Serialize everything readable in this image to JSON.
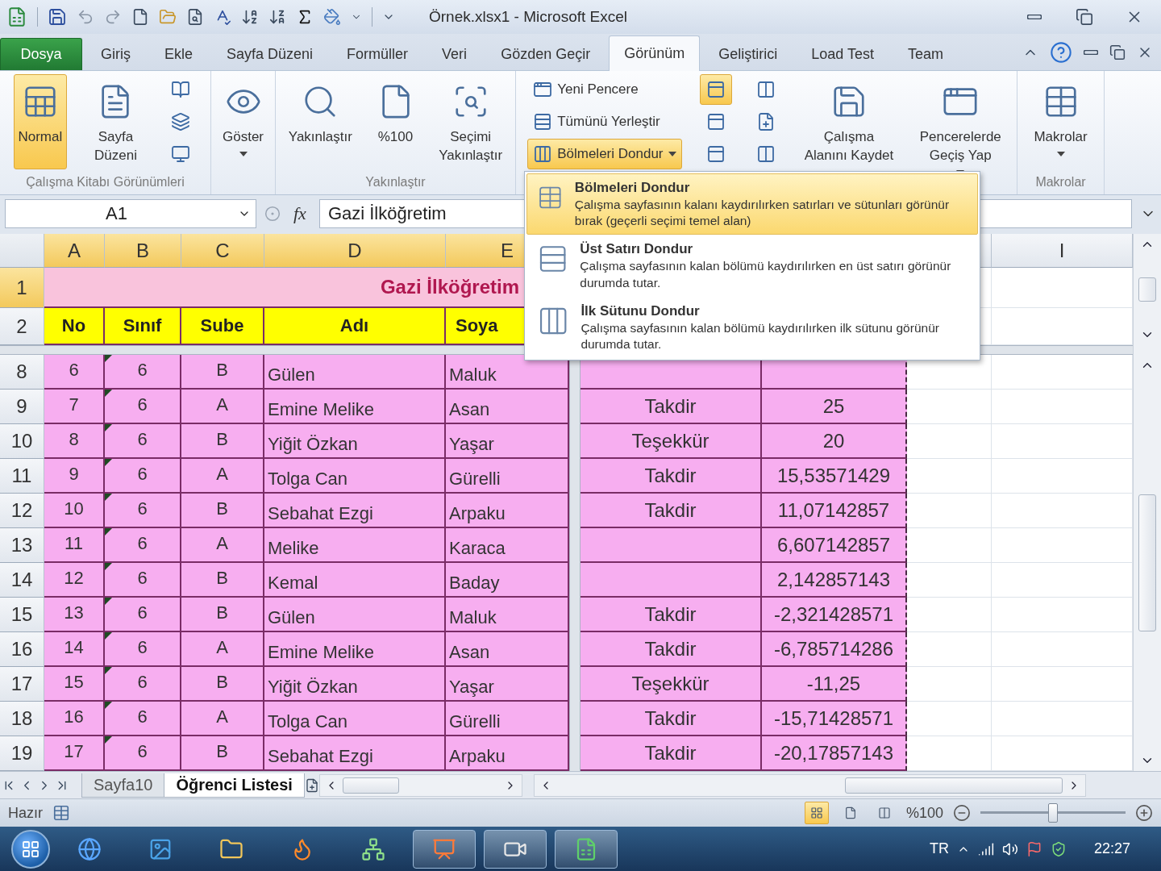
{
  "title_bar": {
    "title": "Örnek.xlsx1 - Microsoft Excel"
  },
  "ribbon_tabs": [
    {
      "label": "Dosya",
      "kind": "file",
      "selected": false
    },
    {
      "label": "Giriş",
      "kind": "tab",
      "selected": false
    },
    {
      "label": "Ekle",
      "kind": "tab",
      "selected": false
    },
    {
      "label": "Sayfa Düzeni",
      "kind": "tab",
      "selected": false
    },
    {
      "label": "Formüller",
      "kind": "tab",
      "selected": false
    },
    {
      "label": "Veri",
      "kind": "tab",
      "selected": false
    },
    {
      "label": "Gözden Geçir",
      "kind": "tab",
      "selected": false
    },
    {
      "label": "Görünüm",
      "kind": "tab",
      "selected": true
    },
    {
      "label": "Geliştirici",
      "kind": "tab",
      "selected": false
    },
    {
      "label": "Load Test",
      "kind": "tab",
      "selected": false
    },
    {
      "label": "Team",
      "kind": "tab",
      "selected": false
    }
  ],
  "ribbon_groups": [
    {
      "label": "Çalışma Kitabı Görünümleri",
      "items": [
        {
          "kind": "large",
          "label": "Normal",
          "selected": true
        },
        {
          "kind": "large",
          "label": "Sayfa\nDüzeni",
          "selected": false
        },
        {
          "kind": "icon-stack",
          "buttons": [
            {
              "selected": false
            },
            {
              "selected": false
            },
            {
              "selected": false
            }
          ]
        }
      ]
    },
    {
      "items": [
        {
          "kind": "large",
          "label": "Göster",
          "selected": false,
          "dropdown": true
        }
      ]
    },
    {
      "label": "Yakınlaştır",
      "items": [
        {
          "kind": "large",
          "label": "Yakınlaştır",
          "selected": false
        },
        {
          "kind": "large",
          "label": "%100",
          "selected": false
        },
        {
          "kind": "large",
          "label": "Seçimi\nYakınlaştır",
          "selected": false
        }
      ]
    },
    {
      "items": [
        {
          "kind": "stack",
          "buttons": [
            {
              "label": "Yeni Pencere",
              "selected": false
            },
            {
              "label": "Tümünü Yerleştir",
              "selected": false
            },
            {
              "label": "Bölmeleri Dondur",
              "selected": true,
              "dropdown": true
            }
          ]
        },
        {
          "kind": "icon-stack",
          "buttons": [
            {
              "selected": true
            },
            {
              "selected": false
            },
            {
              "selected": false
            }
          ]
        },
        {
          "kind": "icon-stack",
          "buttons": [
            {
              "selected": false
            },
            {
              "selected": false
            },
            {
              "selected": false
            }
          ]
        },
        {
          "kind": "large",
          "label": "Çalışma\nAlanını Kaydet",
          "selected": false
        },
        {
          "kind": "large",
          "label": "Pencerelerde\nGeçiş Yap",
          "selected": false,
          "dropdown": true
        }
      ]
    },
    {
      "label": "Makrolar",
      "items": [
        {
          "kind": "large",
          "label": "Makrolar",
          "selected": false,
          "dropdown": true
        }
      ]
    }
  ],
  "formula_bar": {
    "name_box": "A1",
    "function_button": "fx",
    "formula": "Gazi İlköğretim"
  },
  "sheet": {
    "columns": [
      {
        "label": "A",
        "selected": true
      },
      {
        "label": "B",
        "selected": true
      },
      {
        "label": "C",
        "selected": true
      },
      {
        "label": "D",
        "selected": true
      },
      {
        "label": "E",
        "selected": true
      }
    ],
    "right_columns": [
      {
        "label": "I",
        "selected": false
      }
    ],
    "title_row": {
      "number": "1",
      "text": "Gazi İlköğretim",
      "selected": true
    },
    "header_row": {
      "number": "2",
      "selected": false,
      "cells": [
        "No",
        "Sınıf",
        "Sube",
        "Adı",
        "Soya"
      ]
    },
    "rows": [
      {
        "number": "8",
        "cells": [
          "6",
          "6",
          "B",
          "Gülen",
          "Maluk"
        ],
        "flag": true
      },
      {
        "number": "9",
        "cells": [
          "7",
          "6",
          "A",
          "Emine Melike",
          "Asan"
        ],
        "flag": true,
        "note": "Takdir",
        "value": "25"
      },
      {
        "number": "10",
        "cells": [
          "8",
          "6",
          "B",
          "Yiğit Özkan",
          "Yaşar"
        ],
        "flag": true,
        "note": "Teşekkür",
        "value": "20"
      },
      {
        "number": "11",
        "cells": [
          "9",
          "6",
          "A",
          "Tolga Can",
          "Gürelli"
        ],
        "flag": true,
        "note": "Takdir",
        "value": "15,53571429"
      },
      {
        "number": "12",
        "cells": [
          "10",
          "6",
          "B",
          "Sebahat Ezgi",
          "Arpaku"
        ],
        "flag": true,
        "note": "Takdir",
        "value": "11,07142857"
      },
      {
        "number": "13",
        "cells": [
          "11",
          "6",
          "A",
          "Melike",
          "Karaca"
        ],
        "flag": true,
        "value": "6,607142857"
      },
      {
        "number": "14",
        "cells": [
          "12",
          "6",
          "B",
          "Kemal",
          "Baday"
        ],
        "flag": true,
        "value": "2,142857143"
      },
      {
        "number": "15",
        "cells": [
          "13",
          "6",
          "B",
          "Gülen",
          "Maluk"
        ],
        "flag": true,
        "note": "Takdir",
        "value": "-2,321428571"
      },
      {
        "number": "16",
        "cells": [
          "14",
          "6",
          "A",
          "Emine Melike",
          "Asan"
        ],
        "flag": true,
        "note": "Takdir",
        "value": "-6,785714286"
      },
      {
        "number": "17",
        "cells": [
          "15",
          "6",
          "B",
          "Yiğit Özkan",
          "Yaşar"
        ],
        "flag": true,
        "note": "Teşekkür",
        "value": "-11,25"
      },
      {
        "number": "18",
        "cells": [
          "16",
          "6",
          "A",
          "Tolga Can",
          "Gürelli"
        ],
        "flag": true,
        "note": "Takdir",
        "value": "-15,71428571"
      },
      {
        "number": "19",
        "cells": [
          "17",
          "6",
          "B",
          "Sebahat Ezgi",
          "Arpaku"
        ],
        "flag": true,
        "note": "Takdir",
        "value": "-20,17857143"
      }
    ]
  },
  "freeze_menu": {
    "items": [
      {
        "title": "Bölmeleri Dondur",
        "description": "Çalışma sayfasının kalanı kaydırılırken satırları ve sütunları görünür bırak (geçerli seçimi temel alan)",
        "selected": true
      },
      {
        "title": "Üst Satırı Dondur",
        "description": "Çalışma sayfasının kalan bölümü kaydırılırken en üst satırı görünür durumda tutar.",
        "selected": false
      },
      {
        "title": "İlk Sütunu Dondur",
        "description": "Çalışma sayfasının kalan bölümü kaydırılırken ilk sütunu görünür durumda tutar.",
        "selected": false
      }
    ]
  },
  "sheet_tabs": [
    {
      "label": "Sayfa10",
      "selected": false
    },
    {
      "label": "Öğrenci Listesi",
      "selected": true
    }
  ],
  "status_bar": {
    "status": "Hazır",
    "views": [
      {
        "selected": true
      },
      {
        "selected": false
      },
      {
        "selected": false
      }
    ],
    "zoom": "%100",
    "zoom_slider": {
      "level": 0.5
    }
  },
  "taskbar": {
    "apps": [
      {
        "kind": "browser",
        "open": false
      },
      {
        "kind": "image",
        "open": false
      },
      {
        "kind": "folder",
        "open": false
      },
      {
        "kind": "fire",
        "open": false
      },
      {
        "kind": "network",
        "open": false
      },
      {
        "kind": "slides",
        "open": true
      },
      {
        "kind": "video",
        "open": true
      },
      {
        "kind": "sheet",
        "open": true
      }
    ],
    "language": "TR",
    "clock": "22:27"
  }
}
